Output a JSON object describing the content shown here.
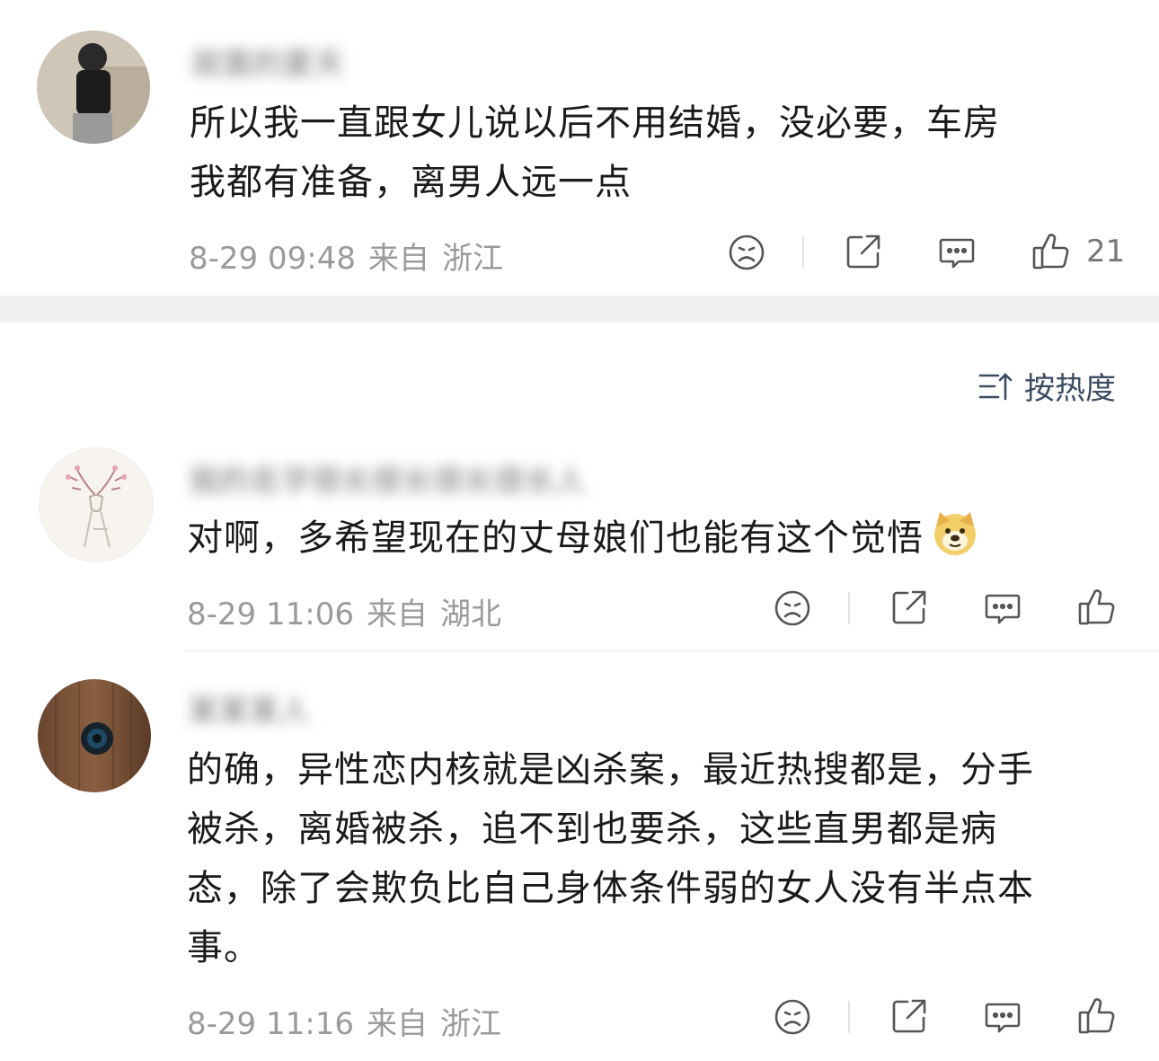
{
  "comments": [
    {
      "username": "寂寞的夏天",
      "text": "所以我一直跟女儿说以后不用结婚，没必要，车房我都有准备，离男人远一点",
      "lines": [
        "所以我一直跟女儿说以后不用结婚，没必要，车房",
        "我都有准备，离男人远一点"
      ],
      "date": "8-29 09:48",
      "from_label": "来自",
      "location": "浙江",
      "likes": "21"
    },
    {
      "username": "我的名字很长很长很长很长人",
      "lines": [
        "对啊，多希望现在的丈母娘们也能有这个觉悟"
      ],
      "emoji": "doge",
      "date": "8-29 11:06",
      "from_label": "来自",
      "location": "湖北",
      "likes": ""
    },
    {
      "username": "某某某人",
      "lines": [
        "的确，异性恋内核就是凶杀案，最近热搜都是，分手",
        "被杀，离婚被杀，追不到也要杀，这些直男都是病",
        "态，除了会欺负比自己身体条件弱的女人没有半点本",
        "事。"
      ],
      "date": "8-29 11:16",
      "from_label": "来自",
      "location": "浙江",
      "likes": ""
    }
  ],
  "sort": {
    "label": "按热度"
  },
  "icons": [
    "frown-icon",
    "share-icon",
    "comment-icon",
    "like-icon",
    "sort-icon"
  ]
}
